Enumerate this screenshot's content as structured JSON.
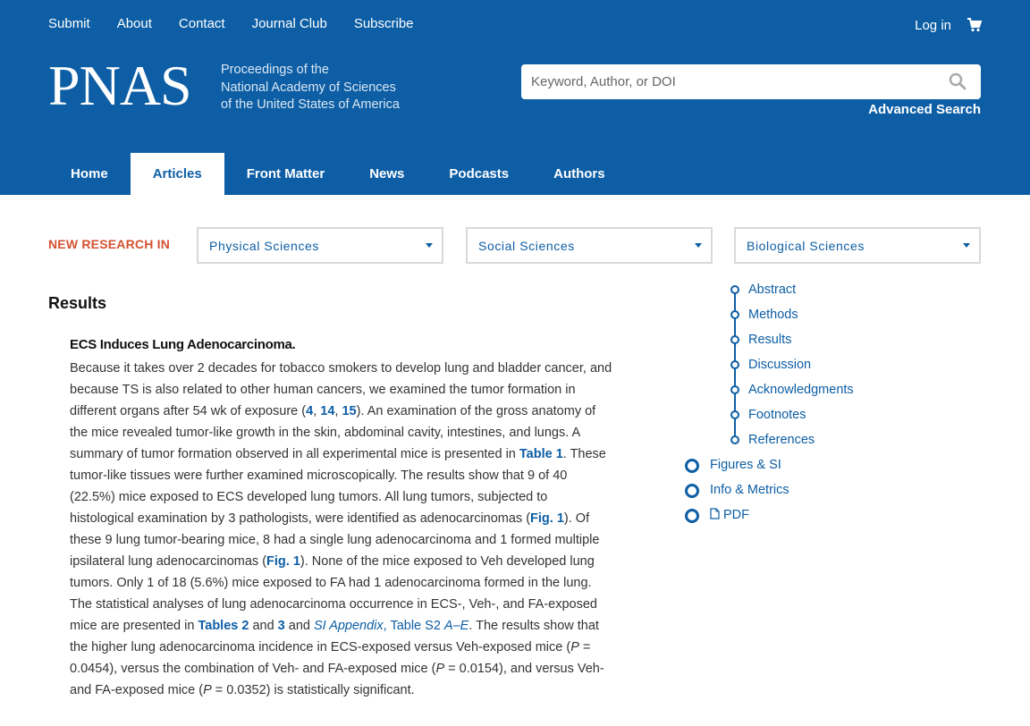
{
  "header": {
    "top_links": [
      "Submit",
      "About",
      "Contact",
      "Journal Club",
      "Subscribe"
    ],
    "login": "Log in",
    "logo": "PNAS",
    "logo_sub": [
      "Proceedings of the",
      "National Academy of Sciences",
      "of the United States of America"
    ],
    "search_placeholder": "Keyword, Author, or DOI",
    "advanced_search": "Advanced Search"
  },
  "nav": {
    "tabs": [
      "Home",
      "Articles",
      "Front Matter",
      "News",
      "Podcasts",
      "Authors"
    ],
    "active": "Articles"
  },
  "research": {
    "label": "NEW RESEARCH IN",
    "dropdowns": [
      "Physical Sciences",
      "Social Sciences",
      "Biological Sciences"
    ]
  },
  "article": {
    "section_title": "Results",
    "subheading": "ECS Induces Lung Adenocarcinoma.",
    "p": {
      "t1": "Because it takes over 2 decades for tobacco smokers to develop lung and bladder cancer, and because TS is also related to other human cancers, we examined the tumor formation in different organs after 54 wk of exposure (",
      "r4": "4",
      "c1": ", ",
      "r14": "14",
      "c2": ", ",
      "r15": "15",
      "t2": "). An examination of the gross anatomy of the mice revealed tumor-like growth in the skin, abdominal cavity, intestines, and lungs. A summary of tumor formation observed in all experimental mice is presented in ",
      "table1": "Table 1",
      "t3": ". These tumor-like tissues were further examined microscopically. The results show that 9 of 40 (22.5%) mice exposed to ECS developed lung tumors. All lung tumors, subjected to histological examination by 3 pathologists, were identified as adenocarcinomas (",
      "fig1a": "Fig. 1",
      "t4": "). Of these 9 lung tumor-bearing mice, 8 had a single lung adenocarcinoma and 1 formed multiple ipsilateral lung adenocarcinomas (",
      "fig1b": "Fig. 1",
      "t5": "). None of the mice exposed to Veh developed lung tumors. Only 1 of 18 (5.6%) mice exposed to FA had 1 adenocarcinoma formed in the lung. The statistical analyses of lung adenocarcinoma occurrence in ECS-, Veh-, and FA-exposed mice are presented in ",
      "tables2": "Tables 2",
      "and1": " and ",
      "three": "3",
      "and2": " and ",
      "si": "SI Appendix",
      "comma": ", ",
      "ts2": "Table S2 ",
      "ae": "A–E",
      "t6": ". The results show that the higher lung adenocarcinoma incidence in ECS-exposed versus Veh-exposed mice (",
      "p1": "P",
      "v1": " = 0.0454), versus the combination of Veh- and FA-exposed mice (",
      "p2": "P",
      "v2": " = 0.0154), and versus Veh- and FA-exposed mice (",
      "p3": "P",
      "v3": " = 0.0352) is statistically significant."
    }
  },
  "toc": {
    "sub_items": [
      "Abstract",
      "Methods",
      "Results",
      "Discussion",
      "Acknowledgments",
      "Footnotes",
      "References"
    ],
    "main_items": [
      "Figures & SI",
      "Info & Metrics",
      "PDF"
    ]
  },
  "colors": {
    "brand_blue": "#0d5ea5",
    "accent_red": "#d4512f"
  },
  "icons": [
    "cart-icon",
    "search-icon",
    "caret-down-icon",
    "pdf-icon"
  ]
}
